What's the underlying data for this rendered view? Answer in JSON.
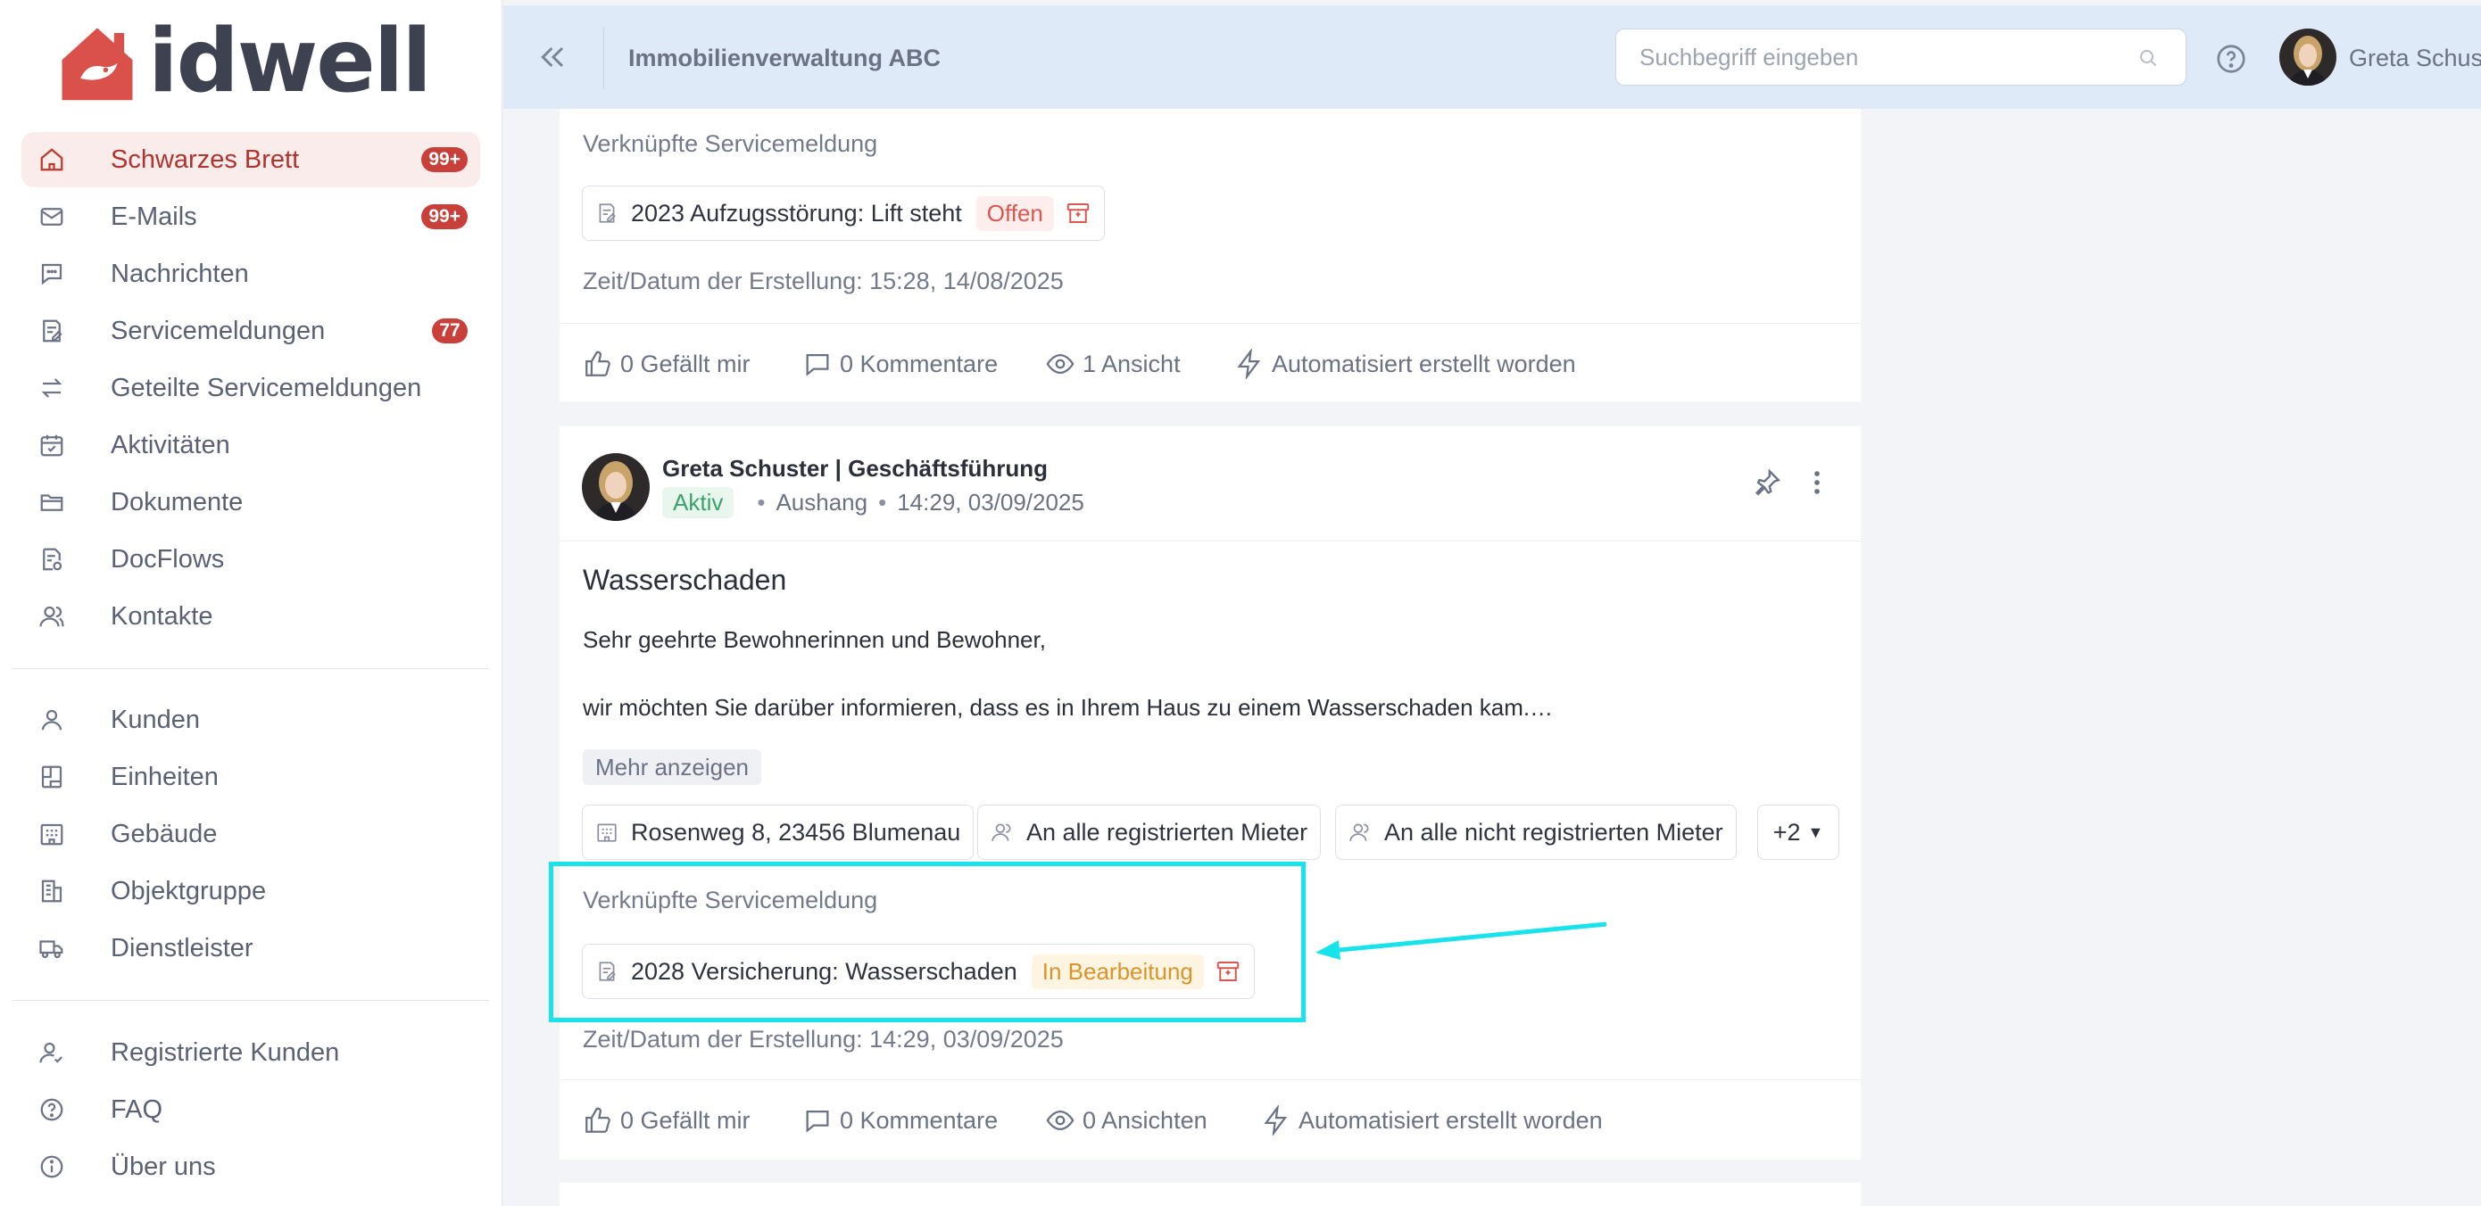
{
  "brand": {
    "name": "idwell",
    "color": "#d9514a"
  },
  "sidebar": {
    "primary": [
      {
        "label": "Schwarzes Brett",
        "icon": "home-icon",
        "badge": "99+",
        "active": true
      },
      {
        "label": "E-Mails",
        "icon": "mail-icon",
        "badge": "99+"
      },
      {
        "label": "Nachrichten",
        "icon": "chat-icon"
      },
      {
        "label": "Servicemeldungen",
        "icon": "service-report-icon",
        "badge": "77"
      },
      {
        "label": "Geteilte Servicemeldungen",
        "icon": "swap-arrows-icon"
      },
      {
        "label": "Aktivitäten",
        "icon": "calendar-check-icon"
      },
      {
        "label": "Dokumente",
        "icon": "folder-icon"
      },
      {
        "label": "DocFlows",
        "icon": "docflow-icon"
      },
      {
        "label": "Kontakte",
        "icon": "contacts-icon"
      }
    ],
    "secondary": [
      {
        "label": "Kunden",
        "icon": "user-icon"
      },
      {
        "label": "Einheiten",
        "icon": "unit-icon"
      },
      {
        "label": "Gebäude",
        "icon": "building-icon"
      },
      {
        "label": "Objektgruppe",
        "icon": "office-building-icon"
      },
      {
        "label": "Dienstleister",
        "icon": "truck-icon"
      }
    ],
    "tertiary": [
      {
        "label": "Registrierte Kunden",
        "icon": "user-check-icon"
      },
      {
        "label": "FAQ",
        "icon": "question-circle-icon"
      },
      {
        "label": "Über uns",
        "icon": "info-circle-icon"
      }
    ]
  },
  "topbar": {
    "title": "Immobilienverwaltung ABC",
    "search_placeholder": "Suchbegriff eingeben",
    "user_name": "Greta Schuster"
  },
  "card1": {
    "linked_label": "Verknüpfte Servicemeldung",
    "linked_item": "2023 Aufzugsstörung: Lift steht",
    "linked_status": "Offen",
    "created": "Zeit/Datum der Erstellung: 15:28, 14/08/2025",
    "likes": "0 Gefällt mir",
    "comments": "0 Kommentare",
    "views": "1 Ansicht",
    "auto": "Automatisiert erstellt worden"
  },
  "card2": {
    "author": "Greta Schuster | Geschäftsführung",
    "status": "Aktiv",
    "type": "Aushang",
    "timestamp": "14:29, 03/09/2025",
    "title": "Wasserschaden",
    "body_greeting": "Sehr geehrte Bewohnerinnen und Bewohner,",
    "body_text": "wir möchten Sie darüber informieren, dass es in Ihrem Haus zu einem Wasserschaden kam.…",
    "more_label": "Mehr anzeigen",
    "recipients": [
      "Rosenweg 8, 23456 Blumenau",
      "An alle registrierten Mieter",
      "An alle nicht registrierten Mieter"
    ],
    "more_recipients": "+2",
    "linked_label": "Verknüpfte Servicemeldung",
    "linked_item": "2028 Versicherung: Wasserschaden",
    "linked_status": "In Bearbeitung",
    "created": "Zeit/Datum der Erstellung: 14:29, 03/09/2025",
    "likes": "0 Gefällt mir",
    "comments": "0 Kommentare",
    "views": "0 Ansichten",
    "auto": "Automatisiert erstellt worden"
  },
  "annotation": {
    "color": "#19e3ea"
  }
}
